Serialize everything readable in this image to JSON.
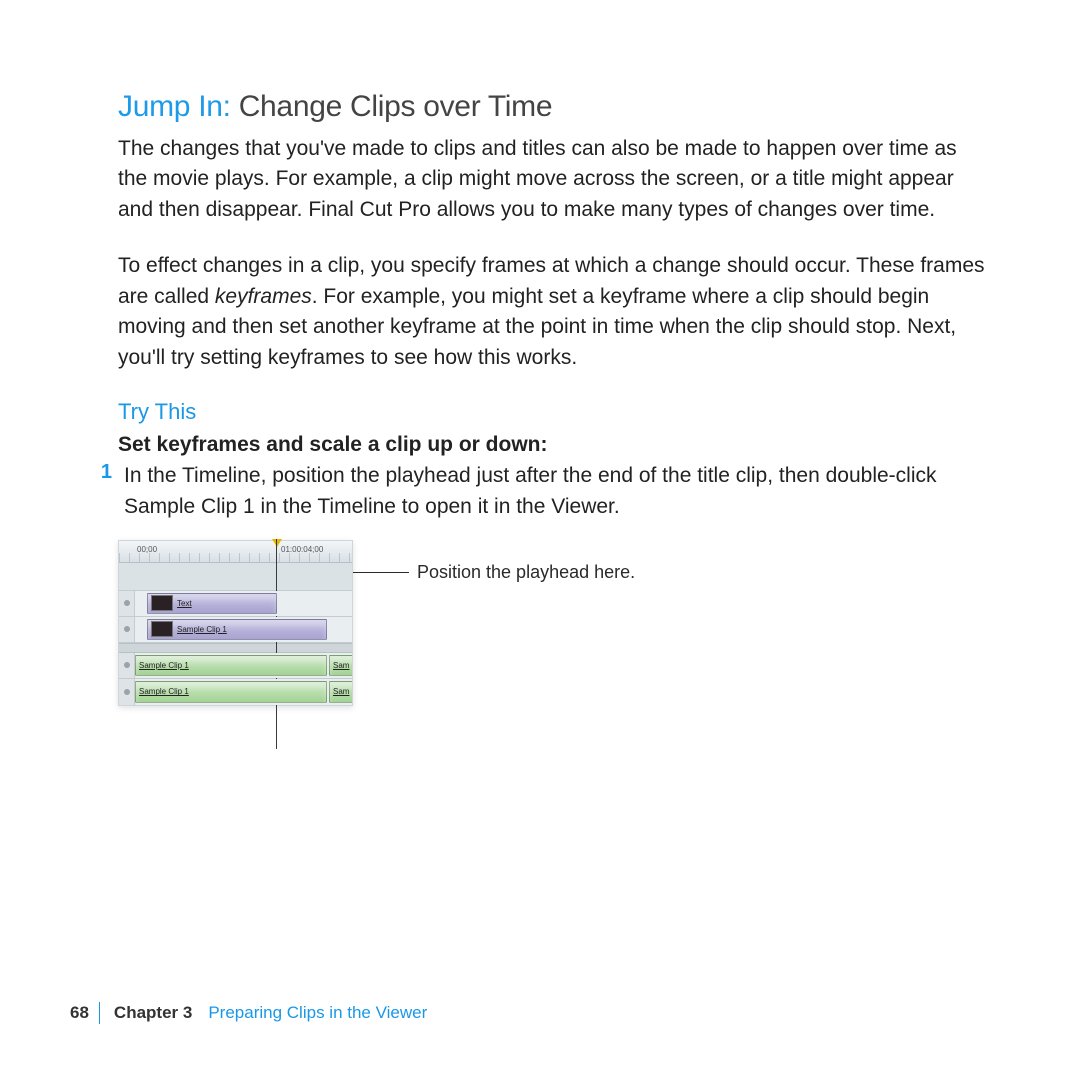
{
  "heading": {
    "lead": "Jump In:  ",
    "rest": "Change Clips over Time"
  },
  "paragraphs": {
    "p1": "The changes that you've made to clips and titles can also be made to happen over time as the movie plays. For example, a clip might move across the screen, or a title might appear and then disappear. Final Cut Pro allows you to make many types of changes over time.",
    "p2a": "To effect changes in a clip, you specify frames at which a change should occur. These frames are called ",
    "p2b_em": "keyframes",
    "p2c": ". For example, you might set a keyframe where a clip should begin moving and then set another keyframe at the point in time when the clip should stop. Next, you'll try setting keyframes to see how this works."
  },
  "try_this": "Try This",
  "task_title": "Set keyframes and scale a clip up or down:",
  "step1": {
    "num": "1",
    "text": "In the Timeline, position the playhead just after the end of the title clip, then double-click Sample Clip 1 in the Timeline to open it in the Viewer."
  },
  "callout": "Position the playhead here.",
  "timeline": {
    "tc0": "00;00",
    "tc1": "01:00:04;00",
    "text_clip": "Text",
    "video_clip": "Sample Clip 1",
    "audio_clip_a": "Sample Clip 1",
    "audio_clip_b": "Sample Clip 1",
    "audio_right_a": "Sam",
    "audio_right_b": "Sam"
  },
  "footer": {
    "page": "68",
    "chapter": "Chapter 3",
    "title": "Preparing Clips in the Viewer"
  }
}
